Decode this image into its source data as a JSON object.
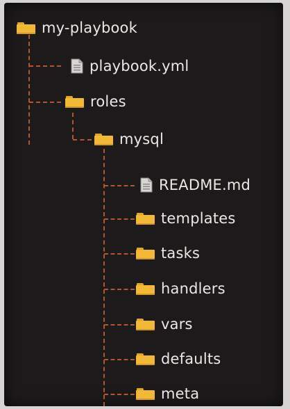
{
  "tree": {
    "root": {
      "label": "my-playbook",
      "icon": "folder-icon"
    },
    "playbook_file": {
      "label": "playbook.yml",
      "icon": "file-icon"
    },
    "roles": {
      "label": "roles",
      "icon": "folder-icon"
    },
    "mysql": {
      "label": "mysql",
      "icon": "folder-icon"
    },
    "children": [
      {
        "label": "README.md",
        "icon": "file-icon"
      },
      {
        "label": "templates",
        "icon": "folder-icon"
      },
      {
        "label": "tasks",
        "icon": "folder-icon"
      },
      {
        "label": "handlers",
        "icon": "folder-icon"
      },
      {
        "label": "vars",
        "icon": "folder-icon"
      },
      {
        "label": "defaults",
        "icon": "folder-icon"
      },
      {
        "label": "meta",
        "icon": "folder-icon"
      }
    ]
  },
  "colors": {
    "background": "#1c1a1a",
    "text": "#ebe9e4",
    "connector": "#b3562d",
    "folder": "#f1b936"
  }
}
